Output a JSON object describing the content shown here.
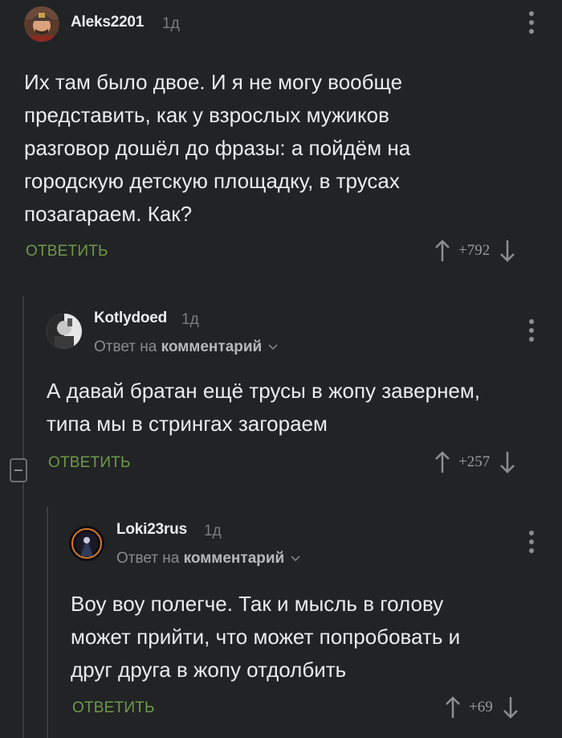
{
  "comments": [
    {
      "username": "Aleks2201",
      "time": "1д",
      "reply_prefix": "",
      "reply_target": "",
      "text_lines": [
        "Их там было двое. И я не могу вообще",
        "представить, как у взрослых мужиков",
        "разговор дошёл до фразы: а пойдём на",
        "городскую детскую площадку, в трусах",
        "позагараем. Как?"
      ],
      "reply_label": "ОТВЕТИТЬ",
      "rating": "+792"
    },
    {
      "username": "Kotlydoed",
      "time": "1д",
      "reply_prefix": "Ответ на",
      "reply_target": "комментарий",
      "text_lines": [
        "А давай братан ещё трусы в жопу завернем,",
        "типа мы в стрингах загораем"
      ],
      "reply_label": "ОТВЕТИТЬ",
      "rating": "+257"
    },
    {
      "username": "Loki23rus",
      "time": "1д",
      "reply_prefix": "Ответ на",
      "reply_target": "комментарий",
      "text_lines": [
        "Воу воу полегче. Так и мысль в голову",
        "может прийти, что может попробовать и",
        "друг друга в жопу отдолбить"
      ],
      "reply_label": "ОТВЕТИТЬ",
      "rating": "+69"
    }
  ],
  "icons": {
    "upvote": "arrow-up-icon",
    "downvote": "arrow-down-icon",
    "more": "more-vertical-icon",
    "collapse": "minus-icon",
    "chevron": "chevron-down-icon"
  },
  "colors": {
    "background": "#222325",
    "reply_green": "#6e9a4a",
    "muted": "#8d8e91"
  }
}
